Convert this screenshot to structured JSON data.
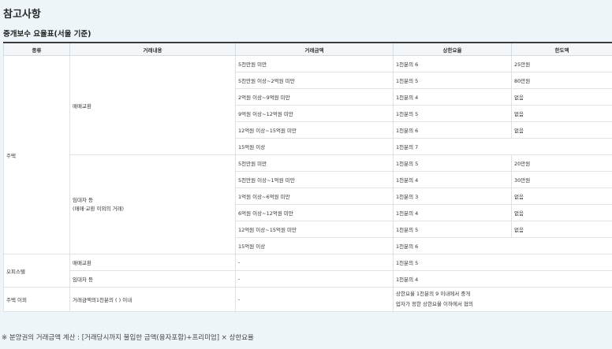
{
  "page_title": "참고사항",
  "table_title": "중개보수 요율표(서울 기준)",
  "headers": [
    "종류",
    "거래내용",
    "거래금액",
    "상한요율",
    "한도액"
  ],
  "types": {
    "house": "주택",
    "officetel": "오피스텔",
    "other": "주택 이외"
  },
  "house_sale": {
    "label": "매매교환",
    "rows": [
      {
        "amount": "5천만원 미만",
        "rate": "1천분의 6",
        "limit": "25만원"
      },
      {
        "amount": "5천만원 이상~2억원 미만",
        "rate": "1천분의 5",
        "limit": "80만원"
      },
      {
        "amount": "2억원 이상~9억원 미만",
        "rate": "1천분의 4",
        "limit": "없음"
      },
      {
        "amount": "9억원 이상~12억원 미만",
        "rate": "1천분의 5",
        "limit": "없음"
      },
      {
        "amount": "12억원 이상~15억원 미만",
        "rate": "1천분의 6",
        "limit": "없음"
      },
      {
        "amount": "15억원 이상",
        "rate": "1천분의 7",
        "limit": ""
      }
    ]
  },
  "house_lease": {
    "label_line1": "임대차 등",
    "label_line2": "(매매·교환 이외의 거래)",
    "rows": [
      {
        "amount": "5천만원 미만",
        "rate": "1천분의 5",
        "limit": "20만원"
      },
      {
        "amount": "5천만원 이상~1억원 미만",
        "rate": "1천분의 4",
        "limit": "30만원"
      },
      {
        "amount": "1억원 이상~6억원 미만",
        "rate": "1천분의 3",
        "limit": "없음"
      },
      {
        "amount": "6억원 이상~12억원 미만",
        "rate": "1천분의 4",
        "limit": "없음"
      },
      {
        "amount": "12억원 이상~15억원 미만",
        "rate": "1천분의 5",
        "limit": "없음"
      },
      {
        "amount": "15억원 이상",
        "rate": "1천분의 6",
        "limit": ""
      }
    ]
  },
  "officetel": {
    "sale_label": "매매교환",
    "sale_amount": "-",
    "sale_rate": "1천분의 5",
    "lease_label": "임대차 등",
    "lease_amount": "-",
    "lease_rate": "1천분의 4"
  },
  "other": {
    "content": "거래금액의1천분의 ( ) 이내",
    "amount": "-",
    "rate_line1": "상한요율 1천분의 9 이내에서 중개",
    "rate_line2": "업자가 정한 상한요율 이하에서 협의"
  },
  "footnote": "※ 분양권의 거래금액 계산 : [거래당시까지 불입한 금액(융자포함)+프리미엄] × 상한요율"
}
